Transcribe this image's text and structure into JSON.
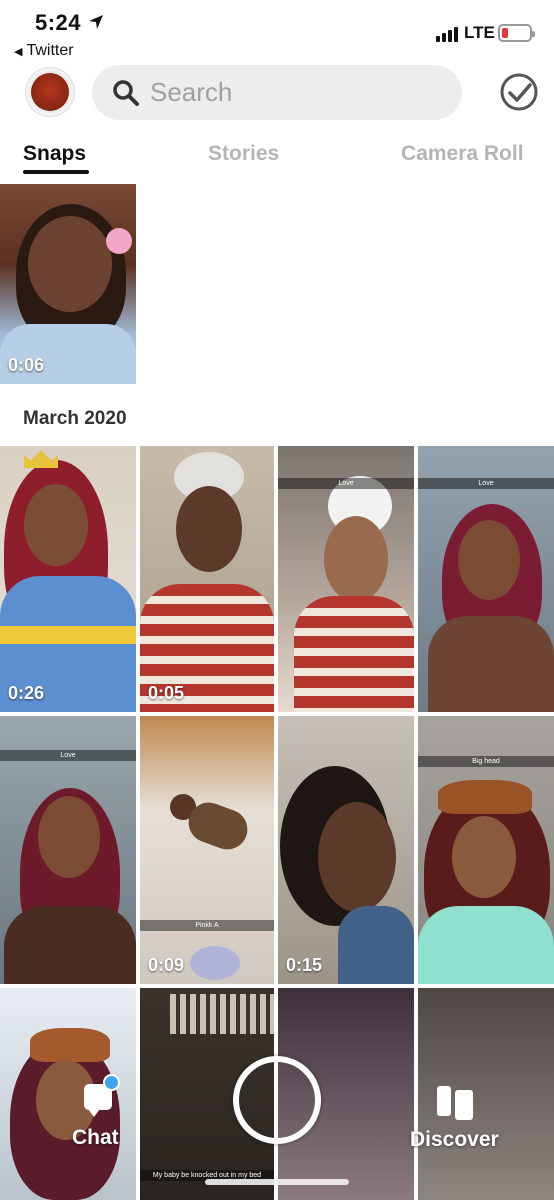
{
  "status_bar": {
    "time": "5:24",
    "back_app": "Twitter",
    "network": "LTE"
  },
  "search": {
    "placeholder": "Search"
  },
  "tabs": [
    {
      "label": "Snaps",
      "active": true
    },
    {
      "label": "Stories",
      "active": false
    },
    {
      "label": "Camera Roll",
      "active": false
    }
  ],
  "top_snap": {
    "duration": "0:06"
  },
  "section": {
    "title": "March 2020"
  },
  "grid": [
    {
      "duration": "0:26",
      "caption": ""
    },
    {
      "duration": "0:05",
      "caption": ""
    },
    {
      "duration": "",
      "caption": "Love"
    },
    {
      "duration": "",
      "caption": "Love"
    },
    {
      "duration": "",
      "caption": "Love"
    },
    {
      "duration": "0:09",
      "caption": "Pinkk A"
    },
    {
      "duration": "0:15",
      "caption": ""
    },
    {
      "duration": "",
      "caption": "Big head"
    },
    {
      "duration": "",
      "caption": ""
    },
    {
      "duration": "",
      "caption": "My baby be knocked out in my bed"
    },
    {
      "duration": "",
      "caption": ""
    },
    {
      "duration": "",
      "caption": ""
    }
  ],
  "bottom_nav": {
    "chat_label": "Chat",
    "discover_label": "Discover"
  },
  "colors": {
    "accent_blue": "#3fa3f0",
    "battery_low": "#e53935",
    "tab_inactive": "#b5b5b5"
  }
}
